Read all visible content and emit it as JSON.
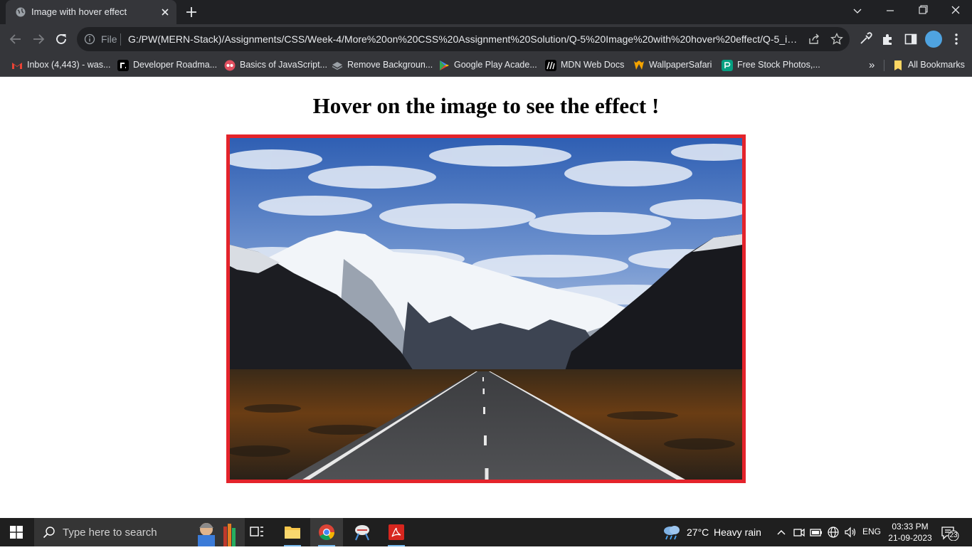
{
  "browser": {
    "tab_title": "Image with hover effect",
    "omnibox_scheme": "File",
    "url": "G:/PW(MERN-Stack)/Assignments/CSS/Week-4/More%20on%20CSS%20Assignment%20Solution/Q-5%20Image%20with%20hover%20effect/Q-5_imag...",
    "bookmarks": [
      {
        "label": "Inbox (4,443) - was...",
        "icon": "gmail-icon",
        "color": "#ea4335"
      },
      {
        "label": "Developer Roadma...",
        "icon": "roadmap-icon",
        "color": "#000000"
      },
      {
        "label": "Basics of JavaScript...",
        "icon": "js-icon",
        "color": "#e04f5f"
      },
      {
        "label": "Remove Backgroun...",
        "icon": "removebg-icon",
        "color": "#9aa0a6"
      },
      {
        "label": "Google Play Acade...",
        "icon": "google-play-icon",
        "color": "#34a853"
      },
      {
        "label": "MDN Web Docs",
        "icon": "mdn-icon",
        "color": "#000000"
      },
      {
        "label": "WallpaperSafari",
        "icon": "wallpapersafari-icon",
        "color": "#f4a300"
      },
      {
        "label": "Free Stock Photos,...",
        "icon": "pexels-icon",
        "color": "#05a081"
      }
    ],
    "bookmarks_more": "»",
    "all_bookmarks": "All Bookmarks"
  },
  "page": {
    "heading": "Hover on the image to see the effect !",
    "frame_color": "#e4232b"
  },
  "taskbar": {
    "search_placeholder": "Type here to search",
    "weather_temp": "27°C",
    "weather_desc": "Heavy rain",
    "language": "ENG",
    "time": "03:33 PM",
    "date": "21-09-2023",
    "notification_count": "23"
  }
}
